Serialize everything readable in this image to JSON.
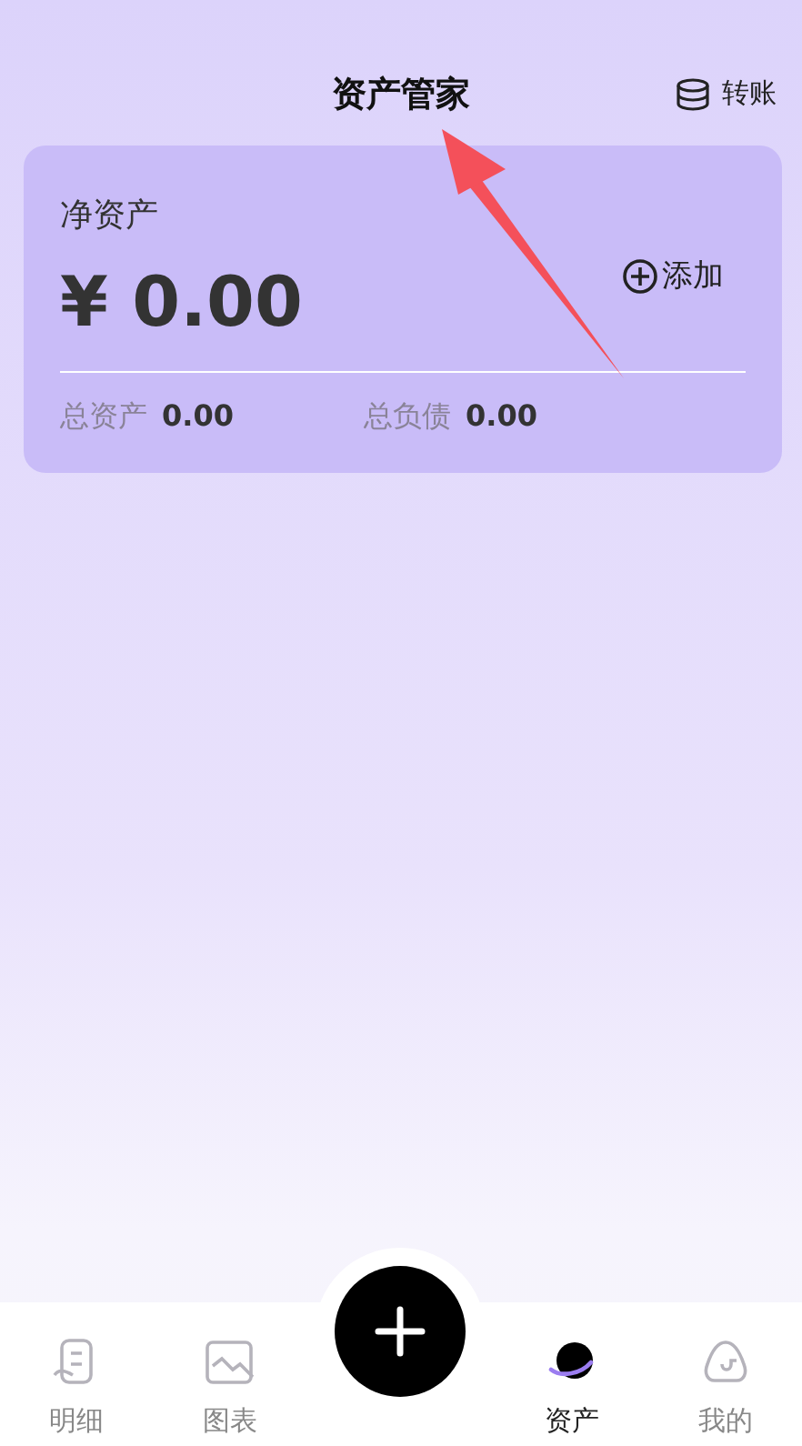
{
  "header": {
    "title": "资产管家",
    "action": "转账"
  },
  "card": {
    "label": "净资产",
    "amount": "¥ 0.00",
    "add": "添加",
    "totals": [
      {
        "label": "总资产",
        "value": "0.00"
      },
      {
        "label": "总负债",
        "value": "0.00"
      }
    ]
  },
  "tabbar": [
    {
      "kind": "tab",
      "label": "明细",
      "selected": false
    },
    {
      "kind": "tab",
      "label": "图表",
      "selected": false
    },
    {
      "kind": "add"
    },
    {
      "kind": "tab",
      "label": "资产",
      "selected": true
    },
    {
      "kind": "tab",
      "label": "我的",
      "selected": false
    }
  ]
}
